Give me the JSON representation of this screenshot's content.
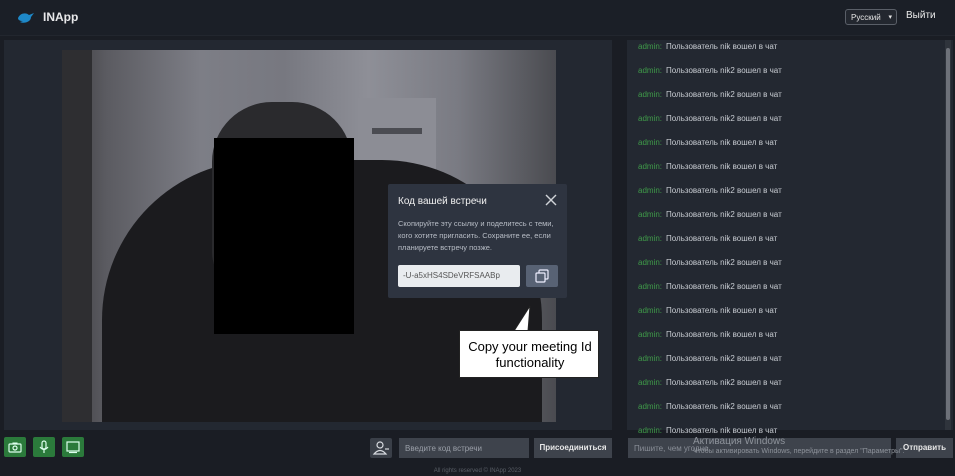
{
  "header": {
    "brand": "INApp",
    "language": "Русский",
    "logout_label": "Выйти",
    "logo_icon": "bird-logo-icon"
  },
  "video": {
    "description_icon": "video-feed"
  },
  "toolbar": {
    "camera_icon": "camera-icon",
    "mic_icon": "microphone-icon",
    "screen_icon": "screen-share-icon",
    "accent_color": "#2b7a3b",
    "meeting_input_placeholder": "Введите код встречи",
    "join_label": "Присоединиться"
  },
  "chat": {
    "messages": [
      {
        "user": "admin:",
        "text": "Пользователь nik вошел в чат"
      },
      {
        "user": "admin:",
        "text": "Пользователь nik2 вошел в чат"
      },
      {
        "user": "admin:",
        "text": "Пользователь nik2 вошел в чат"
      },
      {
        "user": "admin:",
        "text": "Пользователь nik2 вошел в чат"
      },
      {
        "user": "admin:",
        "text": "Пользователь nik вошел в чат"
      },
      {
        "user": "admin:",
        "text": "Пользователь nik вошел в чат"
      },
      {
        "user": "admin:",
        "text": "Пользователь nik2 вошел в чат"
      },
      {
        "user": "admin:",
        "text": "Пользователь nik2 вошел в чат"
      },
      {
        "user": "admin:",
        "text": "Пользователь nik вошел в чат"
      },
      {
        "user": "admin:",
        "text": "Пользователь nik2 вошел в чат"
      },
      {
        "user": "admin:",
        "text": "Пользователь nik2 вошел в чат"
      },
      {
        "user": "admin:",
        "text": "Пользователь nik вошел в чат"
      },
      {
        "user": "admin:",
        "text": "Пользователь nik вошел в чат"
      },
      {
        "user": "admin:",
        "text": "Пользователь nik2 вошел в чат"
      },
      {
        "user": "admin:",
        "text": "Пользователь nik2 вошел в чат"
      },
      {
        "user": "admin:",
        "text": "Пользователь nik2 вошел в чат"
      },
      {
        "user": "admin:",
        "text": "Пользователь nik вошел в чат"
      }
    ],
    "input_placeholder": "Пишите, чем угодно",
    "send_label": "Отправить"
  },
  "modal": {
    "title": "Код вашей встречи",
    "description": "Скопируйте эту ссылку и поделитесь с теми, кого хотите пригласить. Сохраните ее, если планируете встречу позже.",
    "code": "-U-a5xHS4SDeVRFSAABp",
    "close_icon": "close-icon",
    "copy_icon": "copy-icon"
  },
  "callout": {
    "text": "Copy your meeting Id functionality"
  },
  "watermark": {
    "title": "Активация Windows",
    "subtitle": "Чтобы активировать Windows, перейдите в раздел \"Параметры\"."
  },
  "footer": {
    "text": "All rights reserved © INApp 2023"
  }
}
